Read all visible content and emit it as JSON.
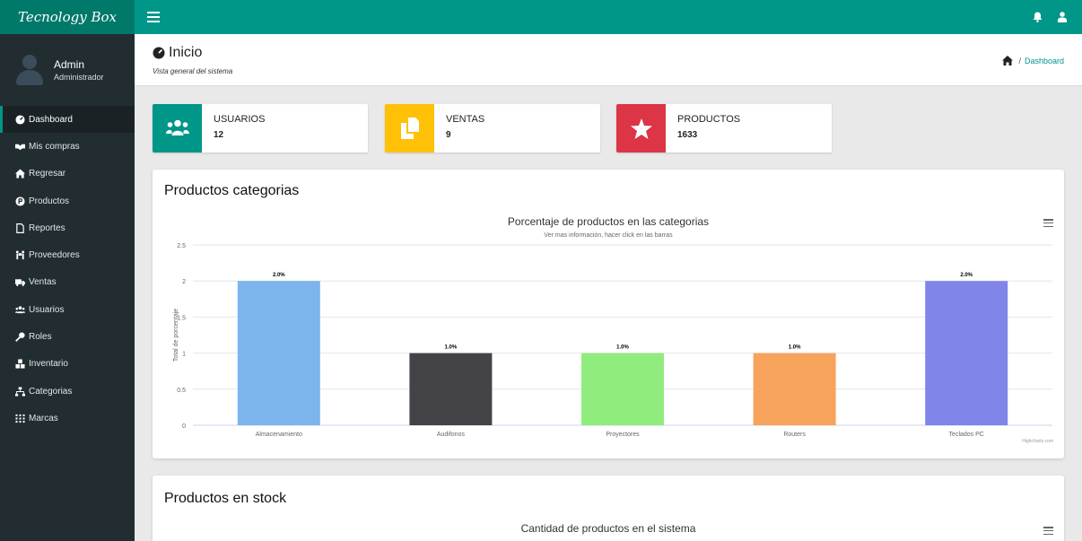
{
  "brand": "Tecnology Box",
  "user": {
    "name": "Admin",
    "role": "Administrador"
  },
  "nav": [
    {
      "label": "Dashboard",
      "icon": "dashboard-icon",
      "active": true
    },
    {
      "label": "Mis compras",
      "icon": "handshake-icon"
    },
    {
      "label": "Regresar",
      "icon": "home-icon"
    },
    {
      "label": "Productos",
      "icon": "product-hunt-icon"
    },
    {
      "label": "Reportes",
      "icon": "file-icon"
    },
    {
      "label": "Proveedores",
      "icon": "people-carry-icon"
    },
    {
      "label": "Ventas",
      "icon": "truck-icon"
    },
    {
      "label": "Usuarios",
      "icon": "users-icon"
    },
    {
      "label": "Roles",
      "icon": "key-icon"
    },
    {
      "label": "Inventario",
      "icon": "cubes-icon"
    },
    {
      "label": "Categorias",
      "icon": "sitemap-icon"
    },
    {
      "label": "Marcas",
      "icon": "grid-icon"
    }
  ],
  "header": {
    "title": "Inicio",
    "subtitle": "Vista general del sistema",
    "breadcrumb": "Dashboard"
  },
  "stats": [
    {
      "label": "USUARIOS",
      "value": "12",
      "color": "#009688",
      "icon": "users-icon"
    },
    {
      "label": "VENTAS",
      "value": "9",
      "color": "#ffc107",
      "icon": "copy-icon"
    },
    {
      "label": "PRODUCTOS",
      "value": "1633",
      "color": "#dc3545",
      "icon": "star-icon"
    }
  ],
  "panel1": {
    "title": "Productos categorias"
  },
  "panel2": {
    "title": "Productos en stock",
    "chart_title": "Cantidad de productos en el sistema"
  },
  "colors": {
    "topbar": "#009688",
    "sidebar": "#222d32",
    "accent": "#009688"
  },
  "chart_data": {
    "type": "bar",
    "title": "Porcentaje de productos en las categorias",
    "subtitle": "Ver mas información, hacer click en las barras",
    "ylabel": "Total de porcentaje",
    "xlabel": "",
    "ylim": [
      0,
      2.5
    ],
    "yticks": [
      "0",
      "0.5",
      "1",
      "1.5",
      "2",
      "2.5"
    ],
    "categories": [
      "Almacenamiento",
      "Audifonos",
      "Proyectores",
      "Routers",
      "Teclados PC"
    ],
    "values": [
      2,
      1,
      1,
      1,
      2
    ],
    "data_labels": [
      "2.0%",
      "1.0%",
      "1.0%",
      "1.0%",
      "2.0%"
    ],
    "colors": [
      "#7cb5ec",
      "#434348",
      "#90ed7d",
      "#f7a35c",
      "#8085e9"
    ],
    "grid": true,
    "legend": "none",
    "credits": "Highcharts.com"
  }
}
